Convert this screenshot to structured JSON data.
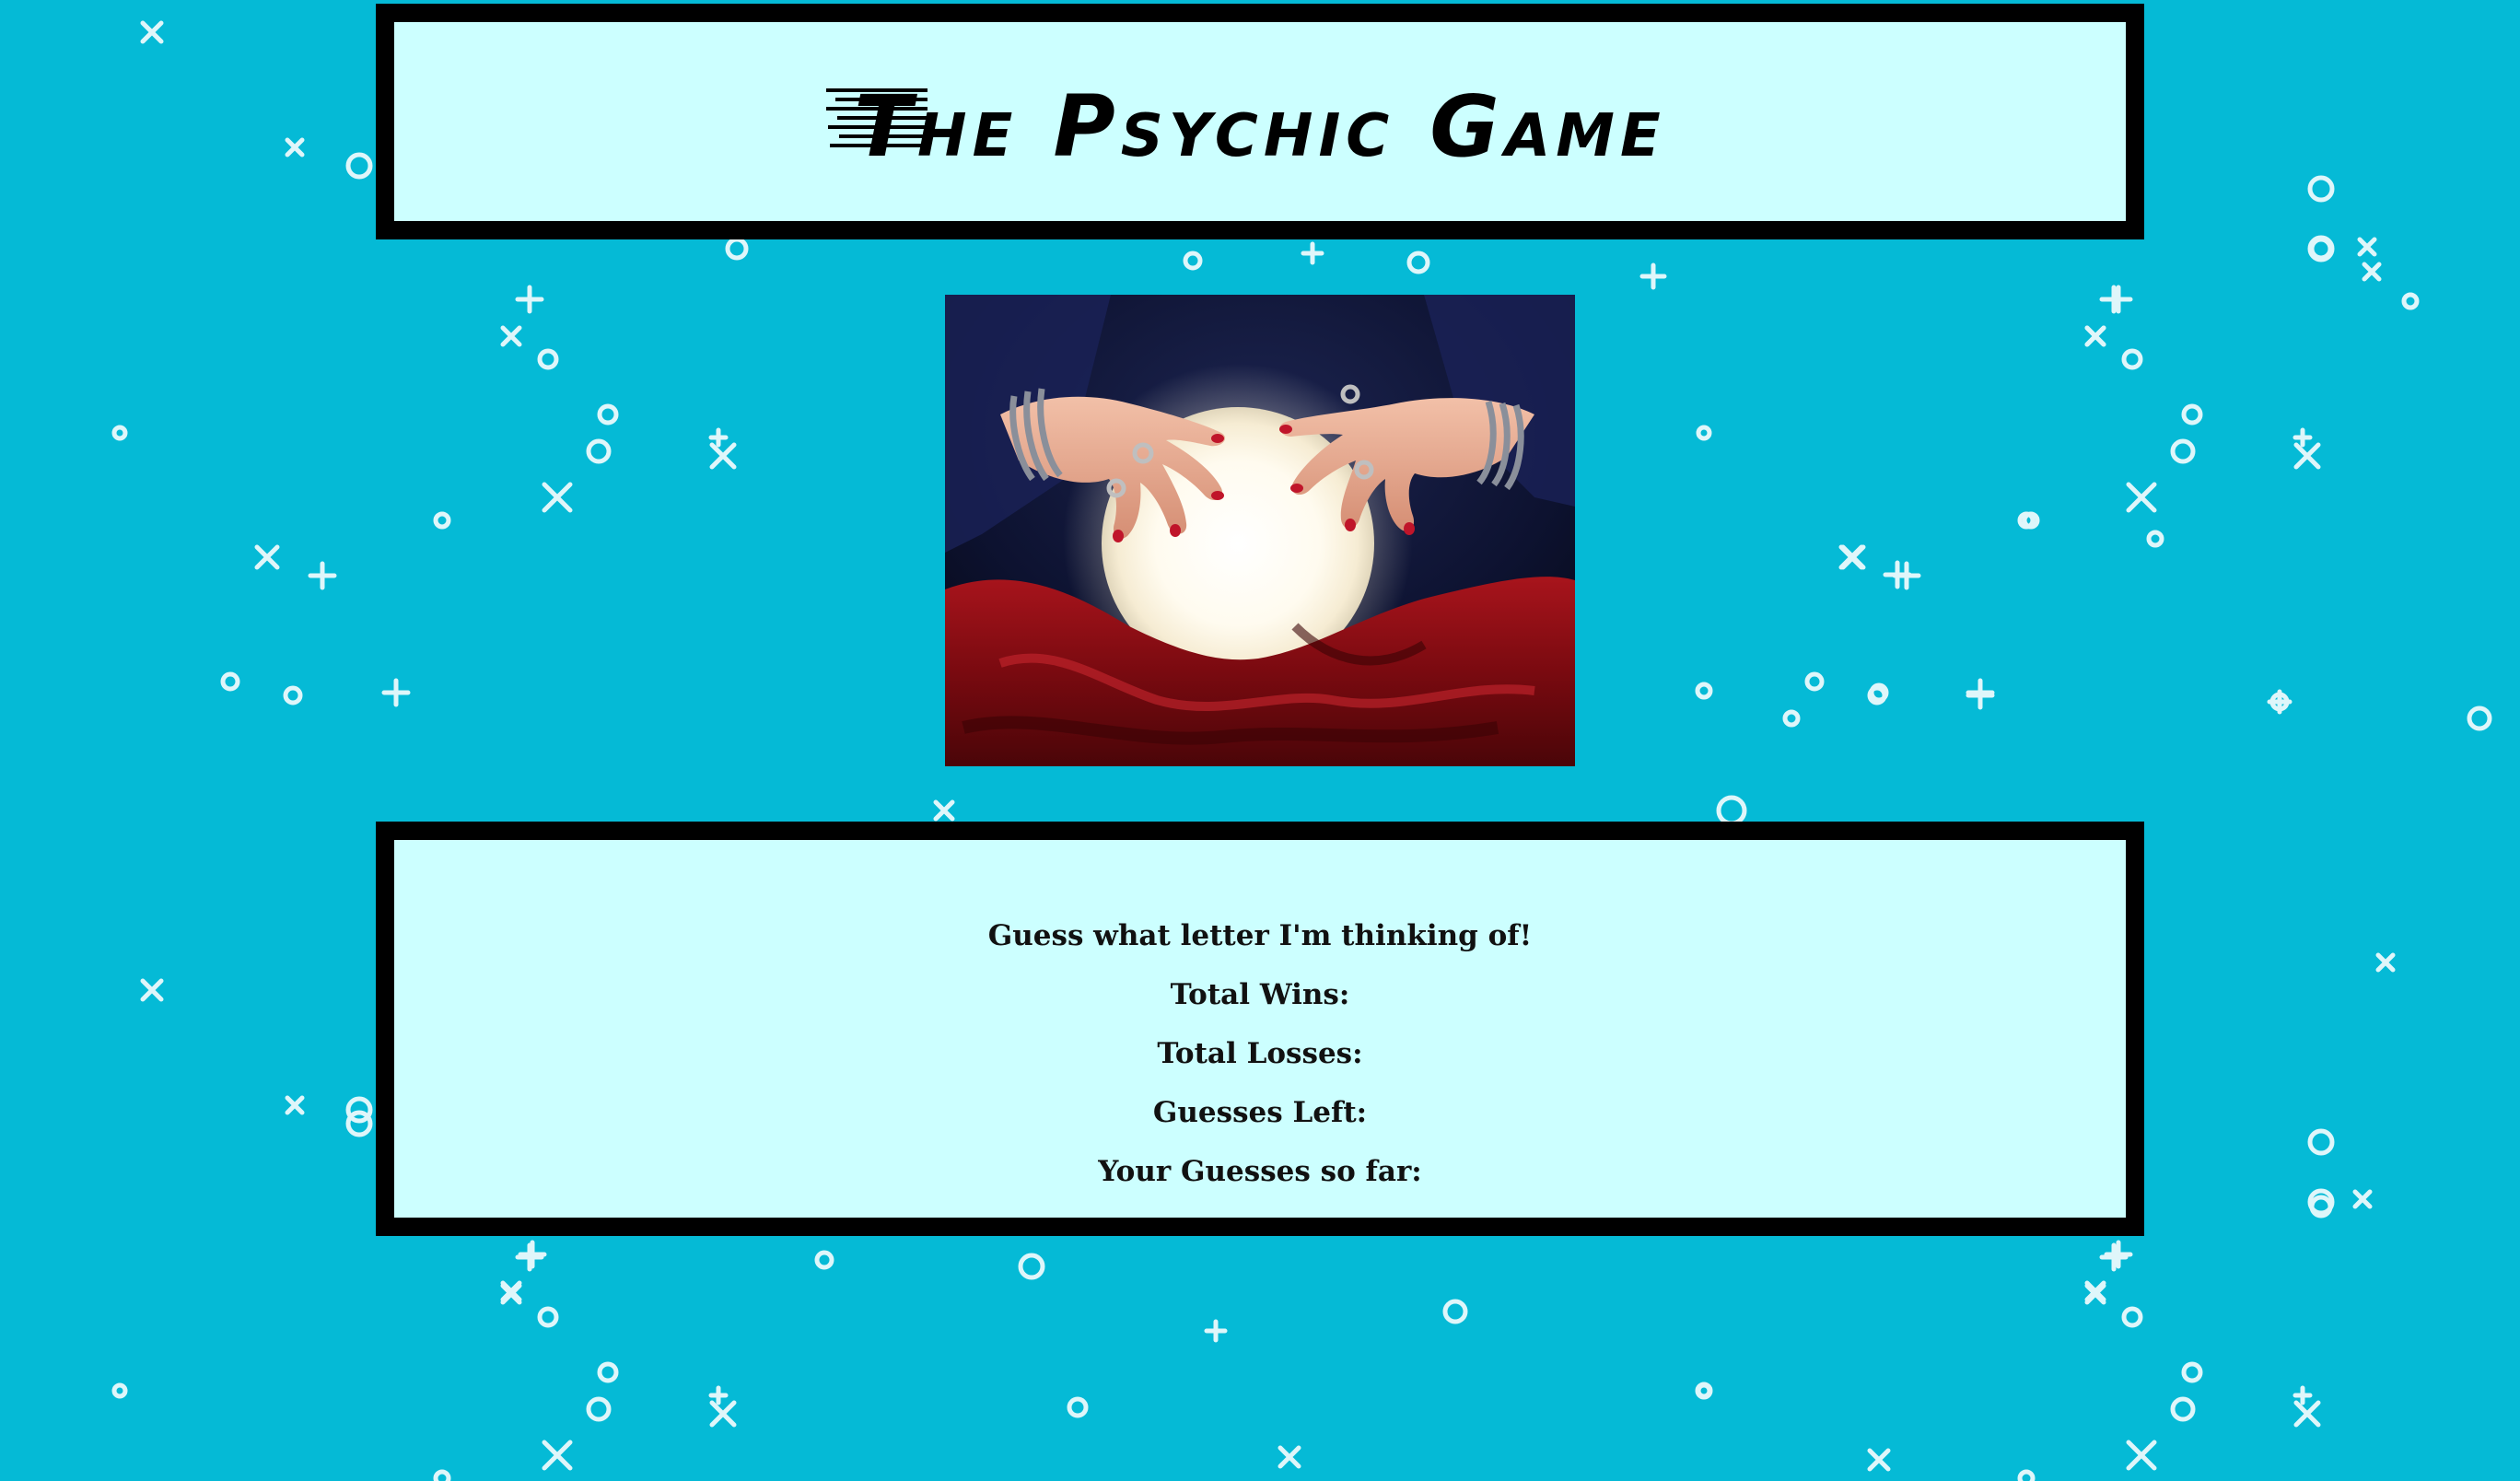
{
  "header": {
    "title": "The Psychic Game"
  },
  "image": {
    "icon": "crystal-ball-image"
  },
  "game": {
    "prompt": "Guess what letter I'm thinking of!",
    "wins_label": "Total Wins:",
    "losses_label": "Total Losses:",
    "guesses_left_label": "Guesses Left:",
    "guesses_so_far_label": "Your Guesses so far:"
  },
  "colors": {
    "background": "#05bad6",
    "panel": "#ccffff",
    "panel_border": "#000000"
  }
}
